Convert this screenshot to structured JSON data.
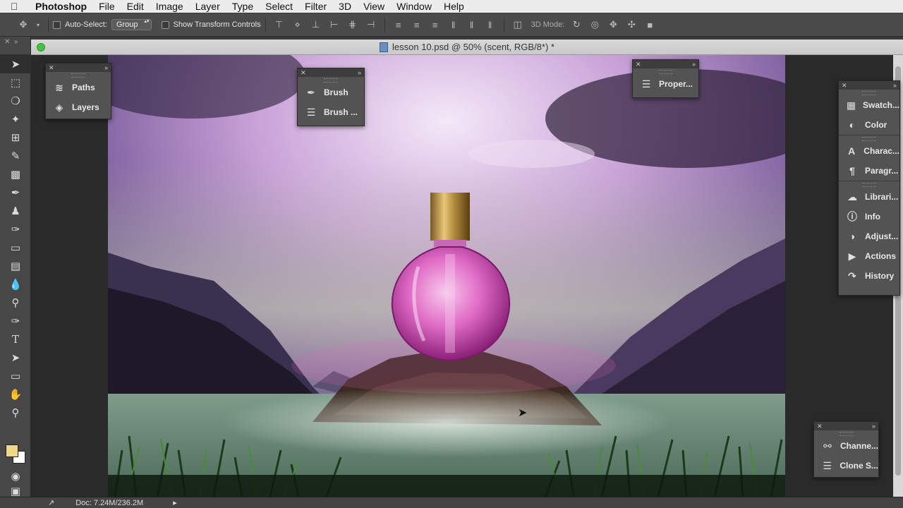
{
  "menubar": {
    "app": "Photoshop",
    "items": [
      "File",
      "Edit",
      "Image",
      "Layer",
      "Type",
      "Select",
      "Filter",
      "3D",
      "View",
      "Window",
      "Help"
    ]
  },
  "options": {
    "auto_select_label": "Auto-Select:",
    "auto_select_value": "Group",
    "show_transform_label": "Show Transform Controls",
    "mode3d_label": "3D Mode:"
  },
  "document": {
    "title": "lesson 10.psd @ 50% (scent, RGB/8*) *"
  },
  "status": {
    "doc_size": "Doc: 7.24M/236.2M"
  },
  "panels": {
    "left_group": [
      {
        "label": "Paths",
        "icon": "paths-icon"
      },
      {
        "label": "Layers",
        "icon": "layers-icon"
      }
    ],
    "brush_group": [
      {
        "label": "Brush",
        "icon": "brush-icon"
      },
      {
        "label": "Brush ...",
        "icon": "brush-presets-icon"
      }
    ],
    "properties_group": [
      {
        "label": "Proper...",
        "icon": "properties-icon"
      }
    ],
    "right_dock": [
      {
        "label": "Swatch...",
        "icon": "swatches-icon"
      },
      {
        "label": "Color",
        "icon": "color-icon"
      },
      {
        "label": "Charac...",
        "icon": "character-icon"
      },
      {
        "label": "Paragr...",
        "icon": "paragraph-icon"
      },
      {
        "label": "Librari...",
        "icon": "libraries-icon"
      },
      {
        "label": "Info",
        "icon": "info-icon"
      },
      {
        "label": "Adjust...",
        "icon": "adjustments-icon"
      },
      {
        "label": "Actions",
        "icon": "actions-icon"
      },
      {
        "label": "History",
        "icon": "history-icon"
      }
    ],
    "bottom_right_group": [
      {
        "label": "Channe...",
        "icon": "channels-icon"
      },
      {
        "label": "Clone S...",
        "icon": "clone-source-icon"
      }
    ]
  },
  "colors": {
    "foreground": "#f0d88a",
    "background": "#ffffff"
  }
}
